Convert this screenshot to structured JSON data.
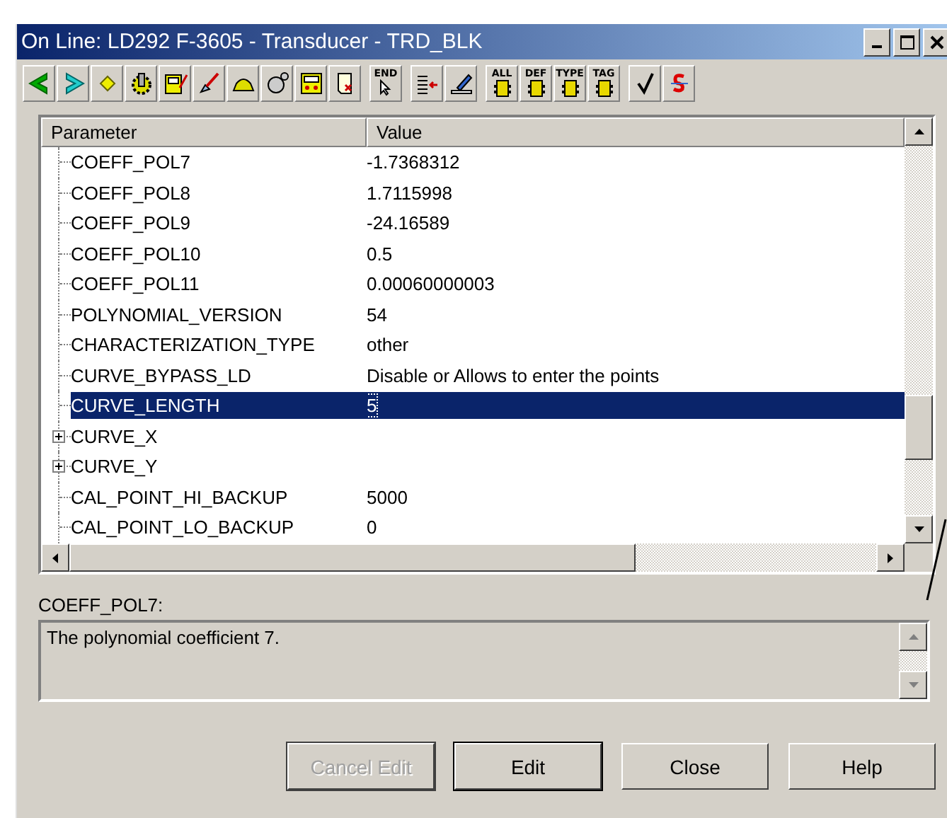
{
  "window": {
    "title": "On Line: LD292 F-3605 - Transducer - TRD_BLK"
  },
  "toolbar": [
    [
      {
        "kind": "back"
      },
      {
        "kind": "forward"
      },
      {
        "kind": "diamond"
      },
      {
        "kind": "gear"
      },
      {
        "kind": "meter"
      },
      {
        "kind": "probe"
      },
      {
        "kind": "hat"
      },
      {
        "kind": "bell"
      },
      {
        "kind": "display"
      },
      {
        "kind": "scroll"
      }
    ],
    [
      {
        "kind": "end",
        "label": "END"
      }
    ],
    [
      {
        "kind": "list"
      },
      {
        "kind": "pen"
      }
    ],
    [
      {
        "kind": "block",
        "label": "ALL"
      },
      {
        "kind": "block",
        "label": "DEF"
      },
      {
        "kind": "block",
        "label": "TYPE"
      },
      {
        "kind": "block",
        "label": "TAG"
      }
    ],
    [
      {
        "kind": "check"
      },
      {
        "kind": "strike"
      }
    ]
  ],
  "table": {
    "columns": [
      "Parameter",
      "Value"
    ],
    "rows": [
      {
        "name": "COEFF_POL7",
        "value": "-1.7368312",
        "expandable": false,
        "selected": false
      },
      {
        "name": "COEFF_POL8",
        "value": "1.7115998",
        "expandable": false,
        "selected": false
      },
      {
        "name": "COEFF_POL9",
        "value": "-24.16589",
        "expandable": false,
        "selected": false
      },
      {
        "name": "COEFF_POL10",
        "value": "0.5",
        "expandable": false,
        "selected": false
      },
      {
        "name": "COEFF_POL11",
        "value": "0.00060000003",
        "expandable": false,
        "selected": false
      },
      {
        "name": "POLYNOMIAL_VERSION",
        "value": "54",
        "expandable": false,
        "selected": false
      },
      {
        "name": "CHARACTERIZATION_TYPE",
        "value": "other",
        "expandable": false,
        "selected": false
      },
      {
        "name": "CURVE_BYPASS_LD",
        "value": "Disable or Allows to enter the points",
        "expandable": false,
        "selected": false
      },
      {
        "name": "CURVE_LENGTH",
        "value": "5",
        "expandable": false,
        "selected": true
      },
      {
        "name": "CURVE_X",
        "expandable": true,
        "selected": false
      },
      {
        "name": "CURVE_Y",
        "expandable": true,
        "selected": false
      },
      {
        "name": "CAL_POINT_HI_BACKUP",
        "value": "5000",
        "expandable": false,
        "selected": false
      },
      {
        "name": "CAL_POINT_LO_BACKUP",
        "value": "0",
        "expandable": false,
        "selected": false
      }
    ]
  },
  "description": {
    "label": "COEFF_POL7:",
    "text": "The polynomial coefficient 7."
  },
  "buttons": [
    {
      "label": "Cancel Edit",
      "disabled": true
    },
    {
      "label": "Edit",
      "disabled": false
    },
    {
      "label": "Close",
      "disabled": false
    },
    {
      "label": "Help",
      "disabled": false
    }
  ]
}
